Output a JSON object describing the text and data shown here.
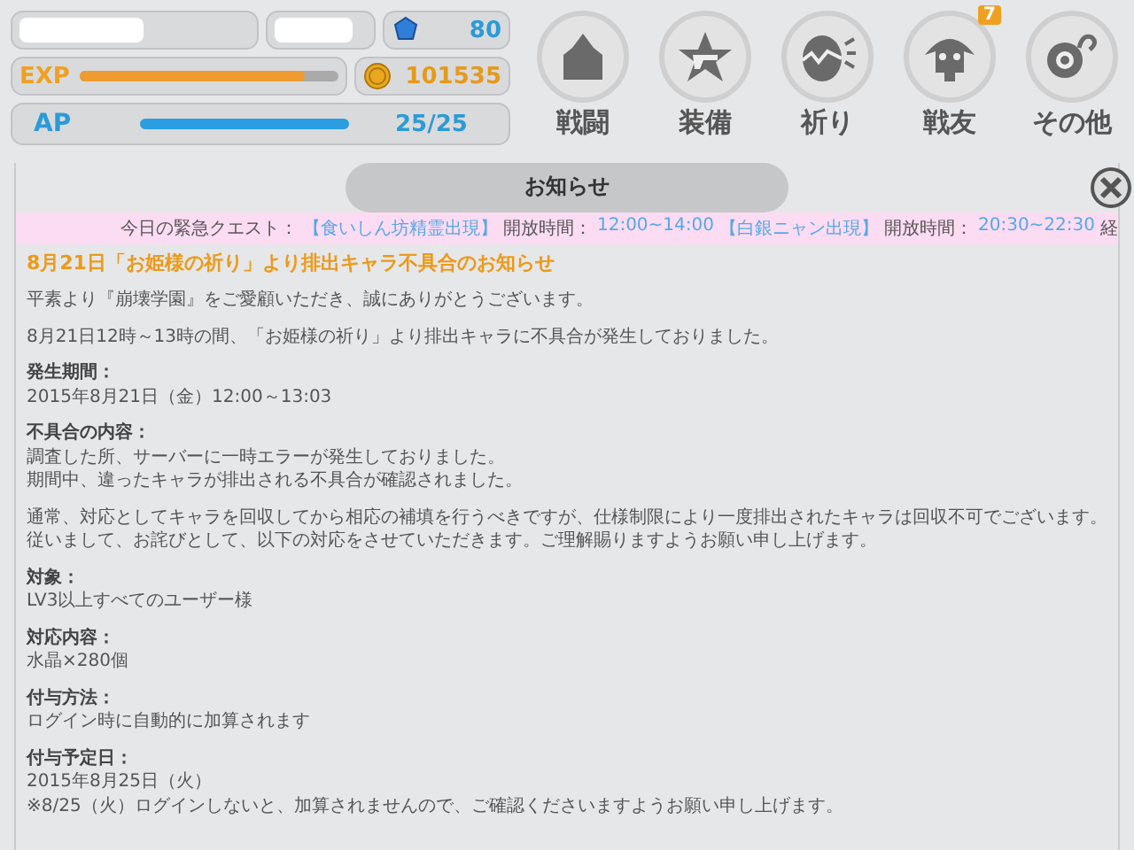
{
  "status": {
    "gems": "80",
    "exp": {
      "label": "EXP",
      "level": 0.87
    },
    "coins": "101535",
    "ap": {
      "label": "AP",
      "level": 1.0,
      "reading": "25/25"
    }
  },
  "nav": [
    {
      "label": "戦闘",
      "kind": "castle"
    },
    {
      "label": "装備",
      "kind": "star"
    },
    {
      "label": "祈り",
      "kind": "egg"
    },
    {
      "label": "戦友",
      "kind": "friend",
      "badge": "7"
    },
    {
      "label": "その他",
      "kind": "misc"
    }
  ],
  "notice": {
    "title": "お知らせ",
    "ticker": [
      {
        "text": "今日の緊急クエスト：",
        "kind": "plain"
      },
      {
        "text": "【食いしん坊精霊出現】",
        "kind": "highlight"
      },
      {
        "text": "開放時間：",
        "kind": "plain"
      },
      {
        "text": "12:00~14:00",
        "kind": "highlight"
      },
      {
        "text": "【白銀ニャン出現】",
        "kind": "highlight"
      },
      {
        "text": "開放時間：",
        "kind": "plain"
      },
      {
        "text": "20:30~22:30",
        "kind": "highlight"
      },
      {
        "text": "経",
        "kind": "plain"
      }
    ],
    "headline": "8月21日「お姫様の祈り」より排出キャラ不具合のお知らせ",
    "sections": [
      {
        "lines": [
          "平素より『崩壊学園』をご愛顧いただき、誠にありがとうございます。"
        ]
      },
      {
        "lines": [
          "8月21日12時～13時の間、「お姫様の祈り」より排出キャラに不具合が発生しておりました。"
        ]
      },
      {
        "heading": "発生期間：",
        "lines": [
          "2015年8月21日（金）12:00～13:03"
        ]
      },
      {
        "heading": "不具合の内容：",
        "lines": [
          "調査した所、サーバーに一時エラーが発生しておりました。",
          "期間中、違ったキャラが排出される不具合が確認されました。"
        ]
      },
      {
        "lines": [
          "通常、対応としてキャラを回収してから相応の補填を行うべきですが、仕様制限により一度排出されたキャラは回収不可でございます。従いまして、お詫びとして、以下の対応をさせていただきます。ご理解賜りますようお願い申し上げます。"
        ]
      },
      {
        "heading": "対象：",
        "lines": [
          "LV3以上すべてのユーザー様"
        ]
      },
      {
        "heading": "対応内容：",
        "lines": [
          "水晶×280個"
        ]
      },
      {
        "heading": "付与方法：",
        "lines": [
          "ログイン時に自動的に加算されます"
        ]
      },
      {
        "heading": "付与予定日：",
        "lines": [
          "2015年8月25日（火）",
          "※8/25（火）ログインしないと、加算されませんので、ご確認くださいますようお願い申し上げます。"
        ]
      }
    ]
  }
}
